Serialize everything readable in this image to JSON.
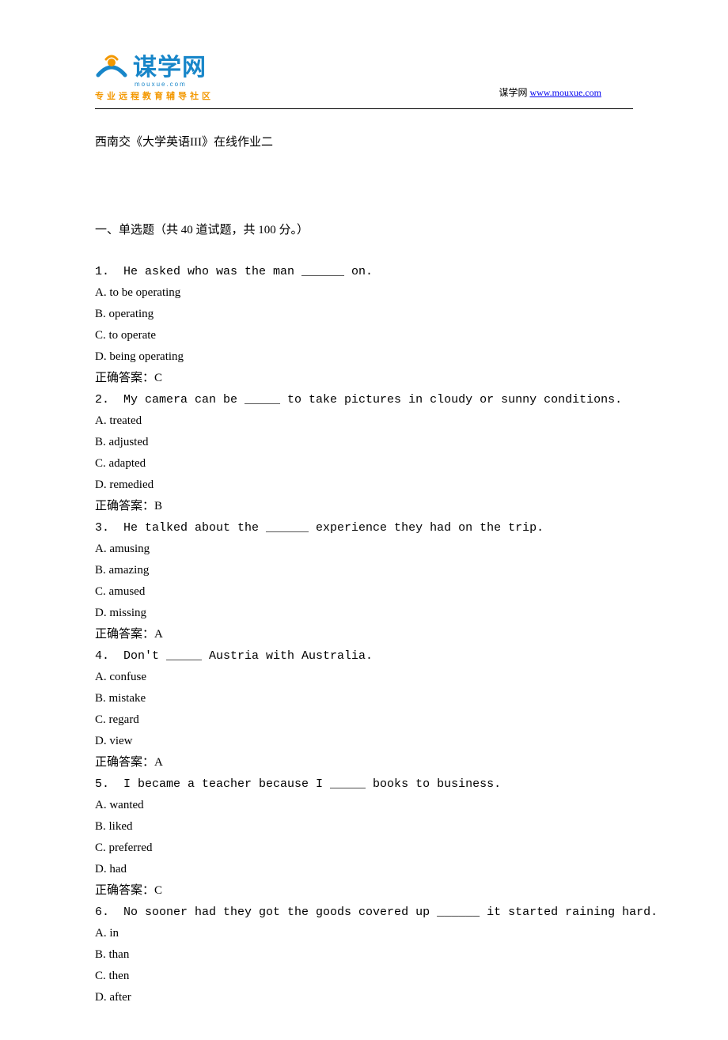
{
  "header": {
    "logo_text": "谋学网",
    "logo_sub": "mouxue.com",
    "logo_tagline": "专业远程教育辅导社区",
    "right_prefix": "谋学网 ",
    "right_link": "www.mouxue.com"
  },
  "title": "西南交《大学英语III》在线作业二",
  "section": "一、单选题（共 40 道试题，共 100 分。）",
  "questions": [
    {
      "num": "1.",
      "stem": "He asked who was the man ______ on.",
      "options": [
        "A. to be operating",
        "B. operating",
        "C. to operate",
        "D. being operating"
      ],
      "answer": "正确答案：C"
    },
    {
      "num": "2.",
      "stem": "My camera can be _____ to take pictures in cloudy or sunny conditions.",
      "options": [
        "A. treated",
        "B. adjusted",
        "C. adapted",
        "D. remedied"
      ],
      "answer": "正确答案：B"
    },
    {
      "num": "3.",
      "stem": "He talked about the ______ experience they had on the trip.",
      "options": [
        "A. amusing",
        "B. amazing",
        "C. amused",
        "D. missing"
      ],
      "answer": "正确答案：A"
    },
    {
      "num": "4.",
      "stem": "Don't _____ Austria with Australia.",
      "options": [
        "A. confuse",
        "B. mistake",
        "C. regard",
        "D. view"
      ],
      "answer": "正确答案：A"
    },
    {
      "num": "5.",
      "stem": "I became a teacher because I _____ books to business.",
      "options": [
        "A. wanted",
        "B. liked",
        "C. preferred",
        "D. had"
      ],
      "answer": "正确答案：C"
    },
    {
      "num": "6.",
      "stem": "No sooner had they got the goods covered up ______ it started raining hard.",
      "options": [
        "A. in",
        "B. than",
        "C. then",
        "D. after"
      ],
      "answer": ""
    }
  ]
}
